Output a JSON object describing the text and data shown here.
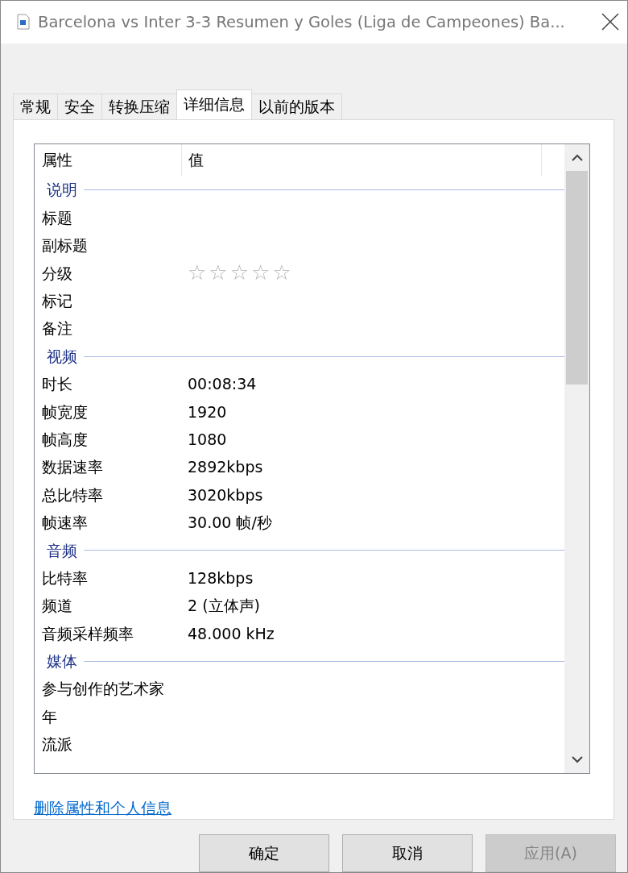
{
  "window": {
    "title": "Barcelona vs Inter 3-3 Resumen y Goles (Liga de Campeones) Ba..."
  },
  "tabs": [
    {
      "label": "常规",
      "selected": false
    },
    {
      "label": "安全",
      "selected": false
    },
    {
      "label": "转换压缩",
      "selected": false
    },
    {
      "label": "详细信息",
      "selected": true
    },
    {
      "label": "以前的版本",
      "selected": false
    }
  ],
  "table": {
    "columns": [
      "属性",
      "值"
    ],
    "groups": [
      {
        "title": "说明",
        "rows": [
          {
            "kind": "text",
            "name": "标题"
          },
          {
            "kind": "text",
            "name": "副标题"
          },
          {
            "kind": "rating",
            "name": "分级",
            "stars": 0
          },
          {
            "kind": "text",
            "name": "标记"
          },
          {
            "kind": "text",
            "name": "备注"
          }
        ]
      },
      {
        "title": "视频",
        "rows": [
          {
            "kind": "text",
            "name": "时长",
            "value": "00:08:34"
          },
          {
            "kind": "text",
            "name": "帧宽度",
            "value": "1920"
          },
          {
            "kind": "text",
            "name": "帧高度",
            "value": "1080"
          },
          {
            "kind": "text",
            "name": "数据速率",
            "value": "2892kbps"
          },
          {
            "kind": "text",
            "name": "总比特率",
            "value": "3020kbps"
          },
          {
            "kind": "text",
            "name": "帧速率",
            "value": "30.00 帧/秒"
          }
        ]
      },
      {
        "title": "音频",
        "rows": [
          {
            "kind": "text",
            "name": "比特率",
            "value": "128kbps"
          },
          {
            "kind": "text",
            "name": "频道",
            "value": "2 (立体声)"
          },
          {
            "kind": "text",
            "name": "音频采样频率",
            "value": "48.000 kHz"
          }
        ]
      },
      {
        "title": "媒体",
        "rows": [
          {
            "kind": "text",
            "name": "参与创作的艺术家"
          },
          {
            "kind": "text",
            "name": "年"
          },
          {
            "kind": "text",
            "name": "流派"
          }
        ]
      }
    ]
  },
  "link": "删除属性和个人信息",
  "buttons": [
    {
      "label": "确定",
      "disabled": false
    },
    {
      "label": "取消",
      "disabled": false
    },
    {
      "label": "应用(A)",
      "disabled": true
    }
  ]
}
